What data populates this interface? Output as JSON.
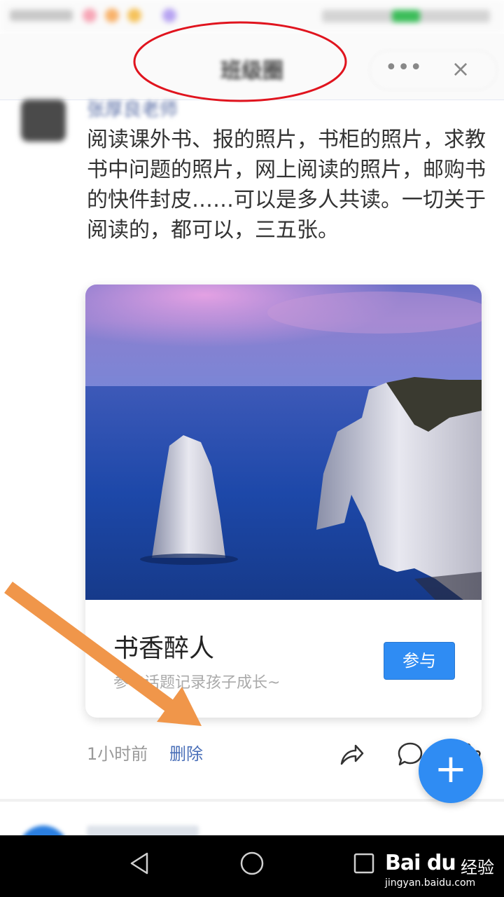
{
  "header": {
    "title": "班级圈",
    "more_icon": "ellipsis-icon",
    "close_icon": "close-icon"
  },
  "post": {
    "author": "张厚良老师",
    "text": "阅读课外书、报的照片，书柜的照片，求教书中问题的照片，网上阅读的照片，邮购书的快件封皮……可以是多人共读。一切关于阅读的，都可以，三五张。",
    "card": {
      "title": "书香醉人",
      "subtitle": "参与话题记录孩子成长~",
      "join_label": "参与"
    },
    "time": "1小时前",
    "delete_label": "删除"
  },
  "fab": {
    "label": "+"
  },
  "next_post": {
    "author": ""
  },
  "watermark": {
    "brand": "Bai du",
    "brand_cn": "经验",
    "url": "jingyan.baidu.com"
  },
  "colors": {
    "accent": "#2f8cf3",
    "link": "#4a6fb8",
    "annotation_red": "#e0141e",
    "annotation_orange": "#f0964a"
  }
}
